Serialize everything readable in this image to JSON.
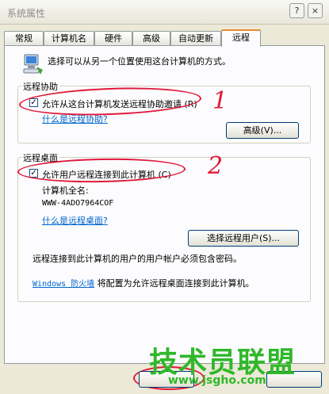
{
  "window": {
    "title": "系统属性",
    "help_btn": "?",
    "close_btn": "×"
  },
  "tabs": [
    {
      "label": "常规"
    },
    {
      "label": "计算机名"
    },
    {
      "label": "硬件"
    },
    {
      "label": "高级"
    },
    {
      "label": "自动更新"
    },
    {
      "label": "远程"
    }
  ],
  "intro_text": "选择可以从另一个位置使用这台计算机的方式。",
  "remote_assistance": {
    "legend": "远程协助",
    "checkbox_label": "允许从这台计算机发送远程协助邀请",
    "checkbox_key": "(R)",
    "checked": true,
    "link": "什么是远程协助?",
    "advanced_btn": "高级(V)..."
  },
  "remote_desktop": {
    "legend": "远程桌面",
    "checkbox_label": "允许用户远程连接到此计算机",
    "checkbox_key": "(C)",
    "checked": true,
    "full_name_label": "计算机全名:",
    "computer_name": "WWW-4ADO7964COF",
    "link": "什么是远程桌面?",
    "select_users_btn": "选择远程用户(S)...",
    "password_note": "远程连接到此计算机的用户的用户帐户必须包含密码。",
    "firewall_link": "Windows 防火墙",
    "firewall_text": "将配置为允许远程桌面连接到此计算机。"
  },
  "annotations": {
    "mark1": "1",
    "mark2": "2"
  },
  "watermark": {
    "text": "技术员联盟",
    "url": "www.jsgho.com"
  },
  "colors": {
    "accent_tab": "#e68b2c",
    "annotation_red": "#e01a3a",
    "watermark_green": "#2fb82a"
  }
}
